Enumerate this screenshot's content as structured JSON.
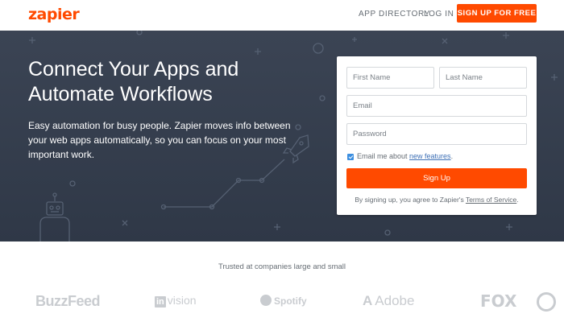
{
  "header": {
    "logo_text": "zapier",
    "nav": [
      {
        "label": "APP DIRECTORY"
      },
      {
        "label": "LOG IN"
      }
    ],
    "cta_label": "SIGN UP FOR FREE"
  },
  "hero": {
    "title_line1": "Connect Your Apps and",
    "title_line2": "Automate Workflows",
    "subtitle": "Easy automation for busy people. Zapier moves info between your web apps automatically, so you can focus on your most important work."
  },
  "signup_form": {
    "first_name_placeholder": "First Name",
    "last_name_placeholder": "Last Name",
    "email_placeholder": "Email",
    "password_placeholder": "Password",
    "checkbox_checked": true,
    "checkbox_text": "Email me about ",
    "checkbox_link": "new features",
    "checkbox_suffix": ".",
    "submit_label": "Sign Up",
    "terms_prefix": "By signing up, you agree to Zapier's ",
    "terms_link": "Terms of Service",
    "terms_suffix": "."
  },
  "trusted": {
    "heading": "Trusted at companies large and small",
    "companies": [
      {
        "name": "BuzzFeed"
      },
      {
        "mark": "in",
        "name": "vision"
      },
      {
        "name": "Spotify",
        "icon": "spotify-icon"
      },
      {
        "mark": "A",
        "name": "Adobe"
      },
      {
        "name": "FOX"
      }
    ]
  },
  "colors": {
    "brand_orange": "#ff4a00",
    "hero_bg": "#343d4c",
    "link_blue": "#3d6fb5",
    "checkbox_blue": "#3d8fe0"
  }
}
